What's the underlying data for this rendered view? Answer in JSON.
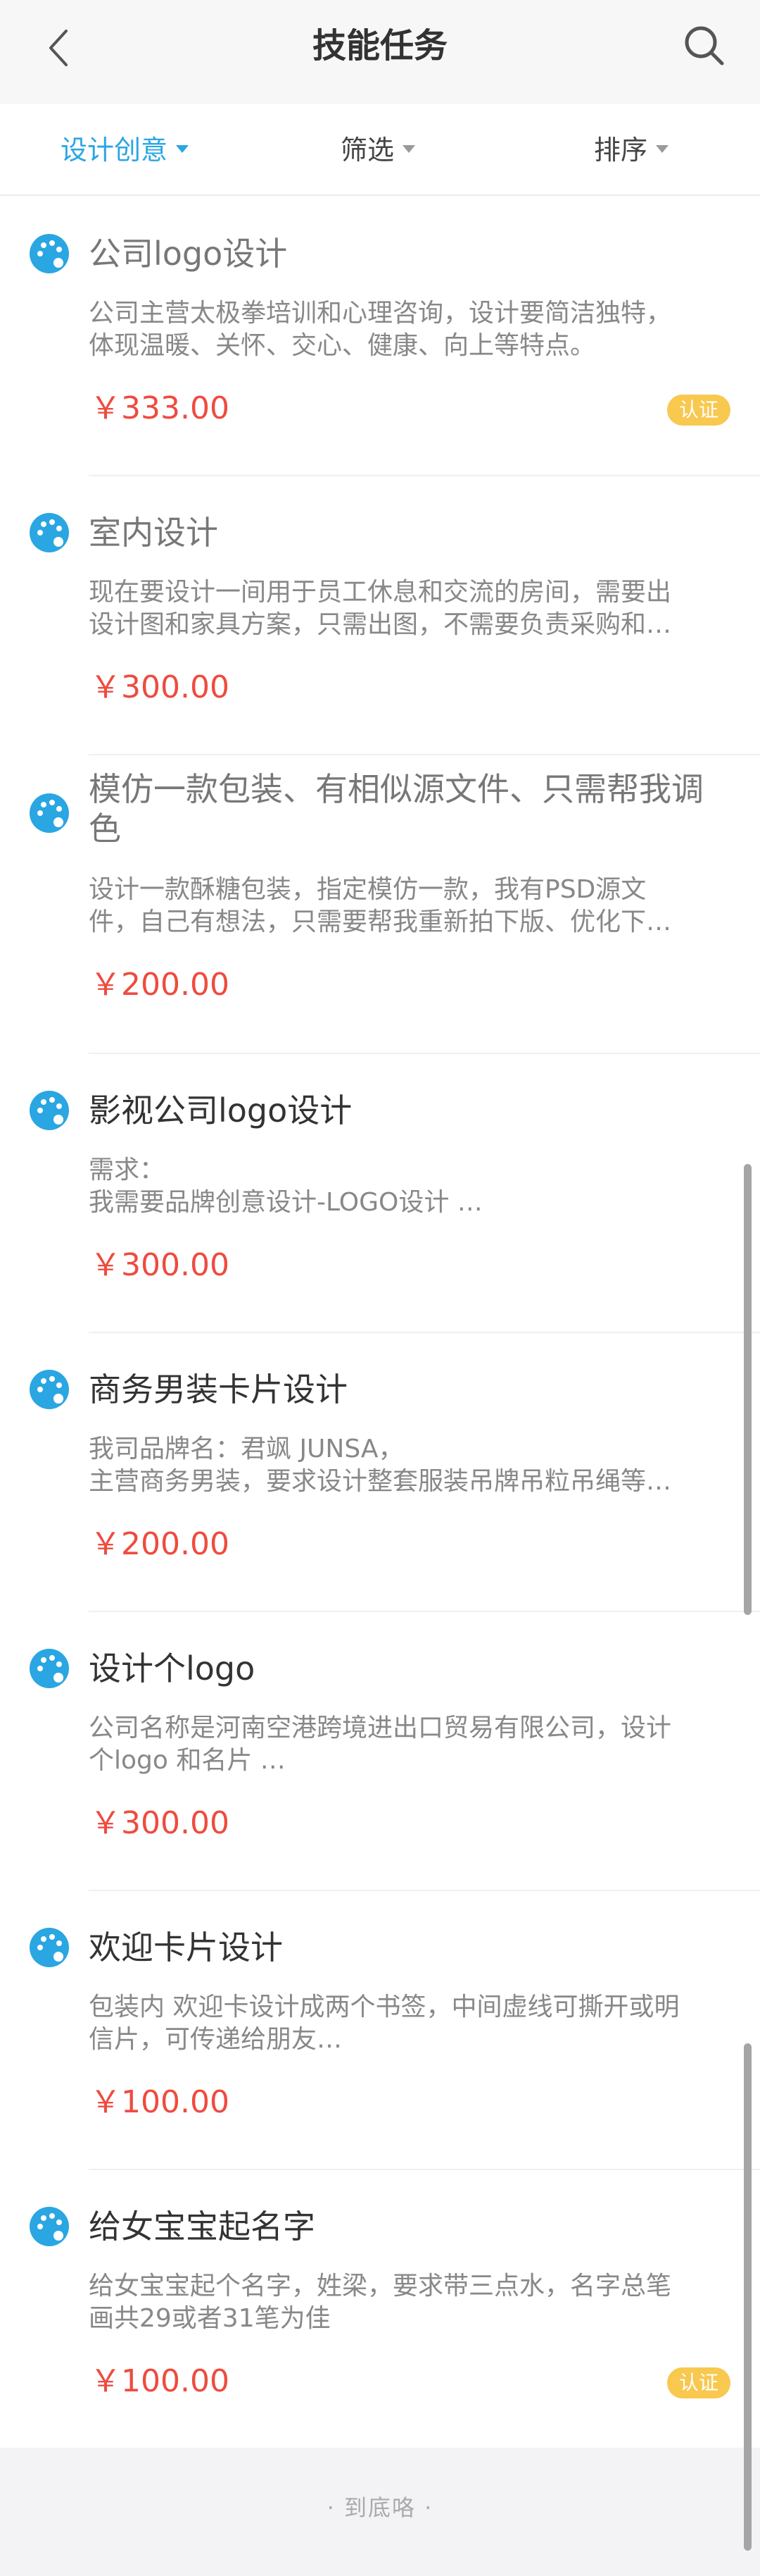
{
  "header": {
    "title": "技能任务",
    "back_icon": "chevron-left-icon",
    "search_icon": "search-icon"
  },
  "filters": {
    "category": "设计创意",
    "filter": "筛选",
    "sort": "排序",
    "active_color": "#2aa6e2"
  },
  "tasks": [
    {
      "title": "公司logo设计",
      "desc": [
        "公司主营太极拳培训和心理咨询，设计要简洁独特，",
        "体现温暖、关怀、交心、健康、向上等特点。"
      ],
      "price": "￥333.00",
      "badge": "认证"
    },
    {
      "title": "室内设计",
      "desc": [
        "现在要设计一间用于员工休息和交流的房间，需要出",
        "设计图和家具方案，只需出图，不需要负责采购和…"
      ],
      "price": "￥300.00"
    },
    {
      "title_lines": [
        "模仿一款包装、有相似源文件、只需帮我调",
        "色"
      ],
      "desc": [
        "设计一款酥糖包装，指定模仿一款，我有PSD源文",
        "件，自己有想法，只需要帮我重新拍下版、优化下…"
      ],
      "price": "￥200.00"
    },
    {
      "title": "影视公司logo设计",
      "desc": [
        "需求：",
        "我需要品牌创意设计-LOGO设计 …"
      ],
      "price": "￥300.00"
    },
    {
      "title": "商务男装卡片设计",
      "desc": [
        "我司品牌名：君飒 JUNSA，",
        "主营商务男装，要求设计整套服装吊牌吊粒吊绳等…"
      ],
      "price": "￥200.00"
    },
    {
      "title": "设计个logo",
      "desc": [
        "公司名称是河南空港跨境进出口贸易有限公司，设计",
        "个logo 和名片 …"
      ],
      "price": "￥300.00"
    },
    {
      "title": "欢迎卡片设计",
      "desc": [
        "包装内 欢迎卡设计成两个书签，中间虚线可撕开或明",
        "信片，可传递给朋友…"
      ],
      "price": "￥100.00"
    },
    {
      "title": "给女宝宝起名字",
      "desc": [
        "给女宝宝起个名字，姓梁，要求带三点水，名字总笔",
        "画共29或者31笔为佳"
      ],
      "price": "￥100.00",
      "badge": "认证"
    }
  ],
  "footer": {
    "text": "· 到底咯 ·"
  },
  "colors": {
    "price": "#ef4b3f",
    "badge": "#f8c84f",
    "icon": "#2aa6e2"
  }
}
